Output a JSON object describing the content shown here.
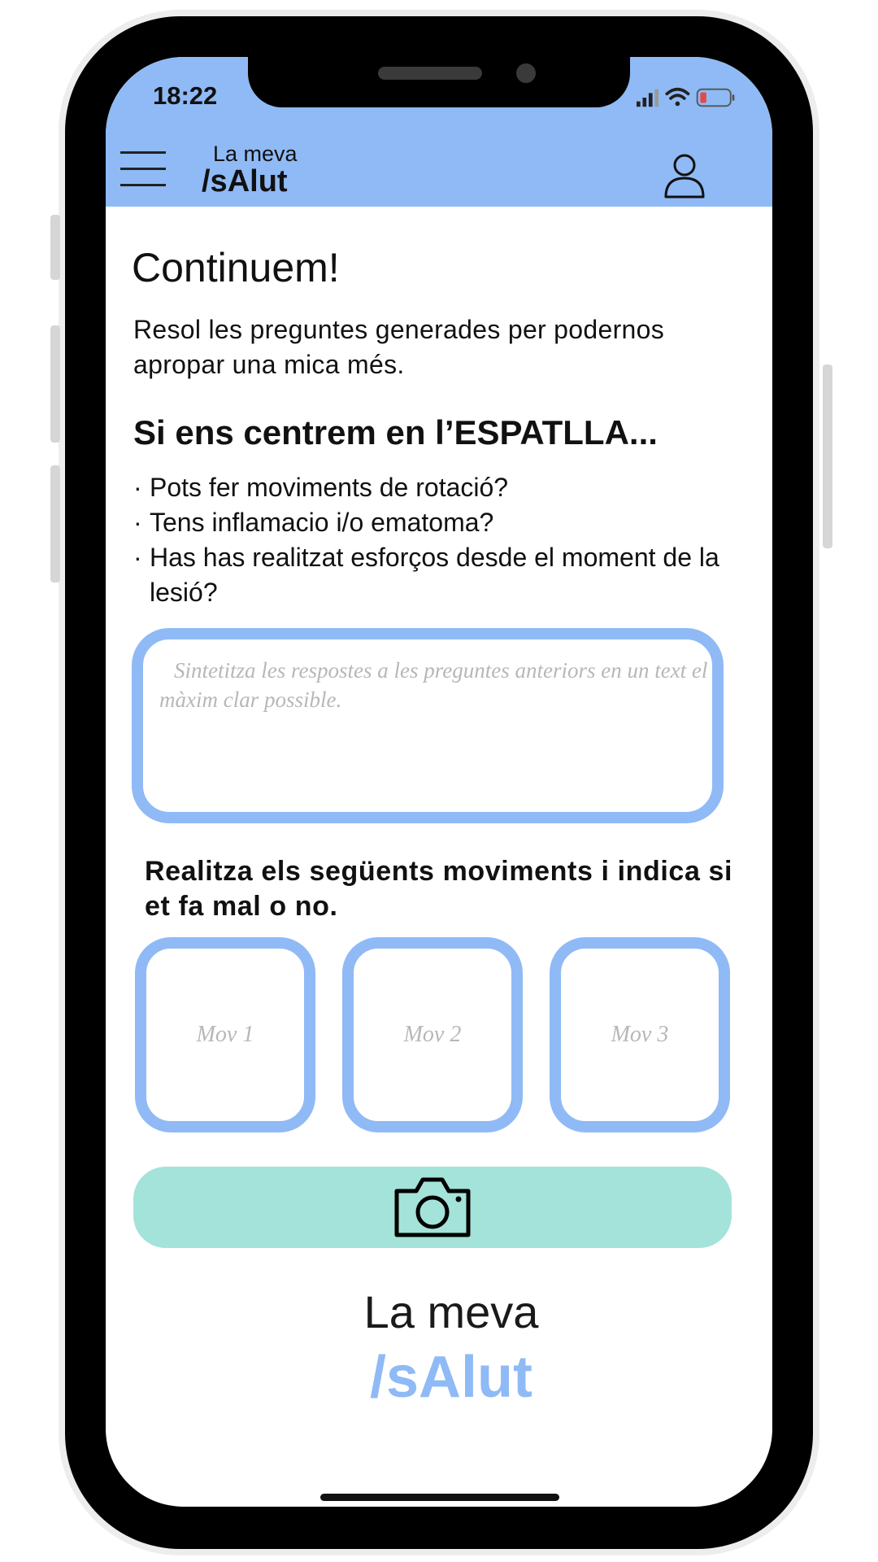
{
  "status_bar": {
    "time": "18:22"
  },
  "header": {
    "brand_small": "La meva",
    "brand_big": "/sAlut"
  },
  "main": {
    "title": "Continuem!",
    "intro": "Resol les preguntes generades per podernos apropar una mica més.",
    "section_title": "Si ens centrem en l’ESPATLLA...",
    "questions": [
      "Pots fer moviments de rotació?",
      "Tens inflamacio i/o ematoma?",
      "Has has realitzat esforços desde el moment de la lesió?"
    ],
    "answer_placeholder": "Sintetitza les respostes a les preguntes anteriors en un text el màxim clar possible.",
    "moves_label": "Realitza els següents moviments i indica si et fa mal o no.",
    "moves": [
      "Mov 1",
      "Mov 2",
      "Mov 3"
    ]
  },
  "footer": {
    "brand_small": "La meva",
    "brand_big": "/sAlut"
  },
  "icons": {
    "menu": "hamburger-icon",
    "user": "user-icon",
    "camera": "camera-icon",
    "signal": "signal-icon",
    "wifi": "wifi-icon",
    "battery": "battery-icon"
  },
  "colors": {
    "header": "#8fbaf5",
    "accent": "#8fbaf5",
    "camera_button": "#a4e3d9",
    "battery_low": "#e24a4a"
  }
}
